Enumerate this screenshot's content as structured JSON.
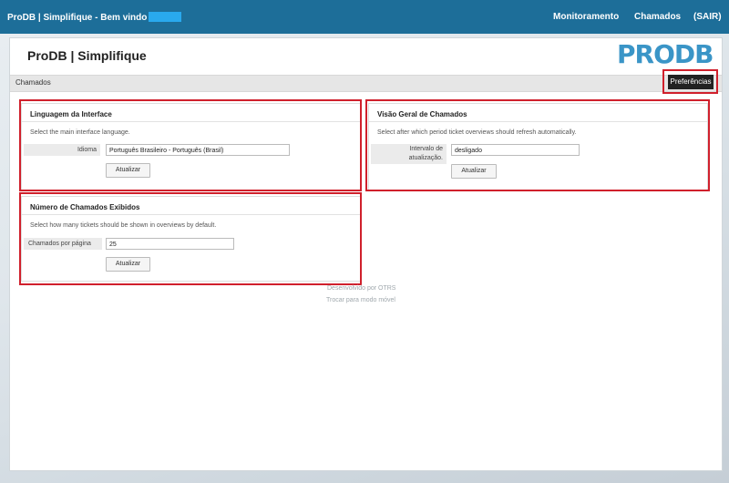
{
  "topbar": {
    "app_title": "ProDB | Simplifique - Bem vindo",
    "nav": {
      "monitoring": "Monitoramento",
      "tickets": "Chamados",
      "logout": "(SAIR)"
    }
  },
  "header": {
    "page_title": "ProDB | Simplifique",
    "logo_text": "PRODB"
  },
  "subnav": {
    "tickets_label": "Chamados",
    "preferences_button": "Preferências"
  },
  "language_box": {
    "title": "Linguagem da Interface",
    "description": "Select the main interface language.",
    "field_label": "Idioma",
    "field_value": "Português Brasileiro - Português (Brasil)",
    "button": "Atualizar"
  },
  "overview_box": {
    "title": "Visão Geral de Chamados",
    "description": "Select after which period ticket overviews should refresh automatically.",
    "field_label_line1": "Intervalo de",
    "field_label_line2": "atualização.",
    "field_value": "desligado",
    "button": "Atualizar"
  },
  "count_box": {
    "title": "Número de Chamados Exibidos",
    "description": "Select how many tickets should be shown in overviews by default.",
    "field_label": "Chamados por página",
    "field_value": "25",
    "button": "Atualizar"
  },
  "footer": {
    "powered_by": "Desenvolvido por OTRS",
    "mobile_mode": "Trocar para modo móvel"
  },
  "colors": {
    "topbar": "#1d6e99",
    "highlight": "#d0202c",
    "logo": "#3a95c7"
  }
}
